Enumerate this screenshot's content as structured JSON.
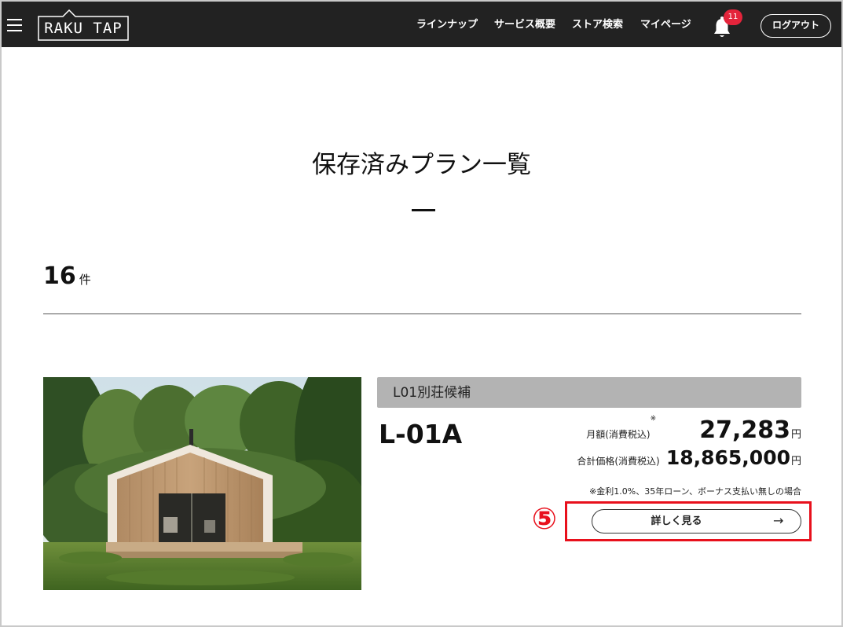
{
  "header": {
    "logo_text": "RAKU TAP",
    "nav": [
      "ラインナップ",
      "サービス概要",
      "ストア検索",
      "マイページ"
    ],
    "notification_count": "11",
    "logout_label": "ログアウト"
  },
  "page": {
    "title": "保存済みプラン一覧",
    "count": "16",
    "count_unit": "件"
  },
  "plans": [
    {
      "label": "L01別荘候補",
      "model": "L-01A",
      "monthly_label": "月額(消費税込)",
      "monthly_mark": "※",
      "monthly_value": "27,283",
      "monthly_unit": "円",
      "total_label": "合計価格(消費税込)",
      "total_value": "18,865,000",
      "total_unit": "円",
      "note": "※金利1.0%、35年ローン、ボーナス支払い無しの場合",
      "detail_label": "詳しく見る",
      "detail_arrow": "→"
    }
  ],
  "annotation": {
    "step": "⑤",
    "color": "#e8101c"
  },
  "colors": {
    "header_bg": "#222222",
    "badge": "#e4243b",
    "plan_label_bg": "#b3b3b3"
  },
  "icons": [
    "hamburger-menu-icon",
    "bell-icon",
    "arrow-right-icon"
  ]
}
